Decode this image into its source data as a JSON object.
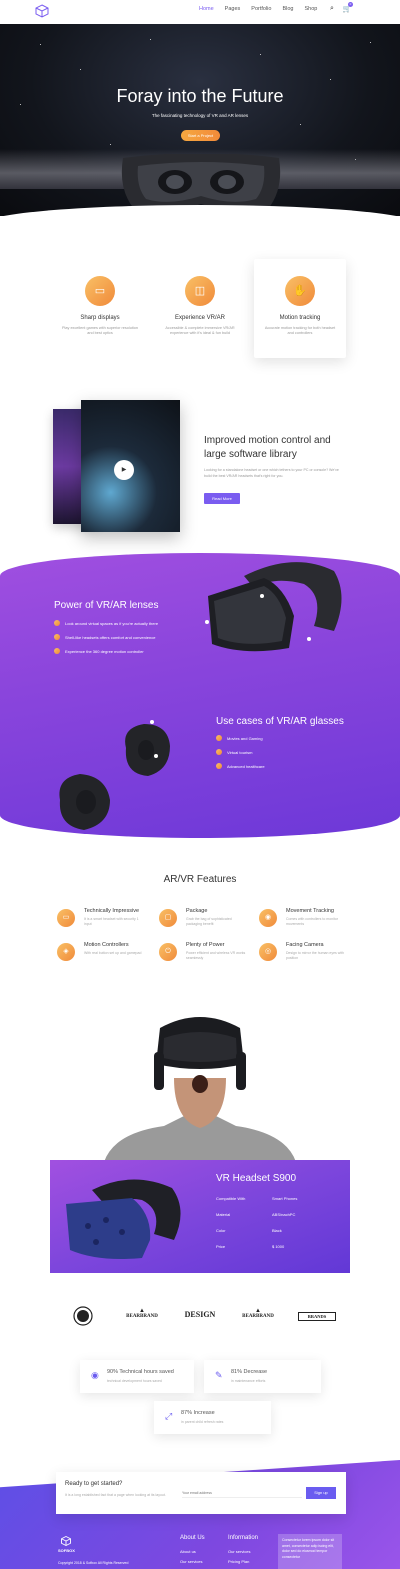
{
  "nav": {
    "items": [
      "Home",
      "Pages",
      "Portfolio",
      "Blog",
      "Shop"
    ],
    "cart_count": "0"
  },
  "hero": {
    "title": "Foray into the Future",
    "subtitle": "The fascinating technology of VR and AR lenses",
    "cta": "Start a Project"
  },
  "features": [
    {
      "icon": "vr-goggles-icon",
      "title": "Sharp displays",
      "text": "Play excellent games with superior resolution and best optics"
    },
    {
      "icon": "vr-headset-icon",
      "title": "Experience VR/AR",
      "text": "Accessible & complete immersive VR/AR experience with it's ideal & fun build"
    },
    {
      "icon": "hand-tracking-icon",
      "title": "Motion tracking",
      "text": "Accurate motion tracking for both headset and controllers"
    }
  ],
  "motion": {
    "title": "Improved motion control and large software library",
    "text": "Looking for a standalone headset or one which tethers to your PC or console? We've build the best VR/AR headsets that's right for you.",
    "button": "Read More"
  },
  "lenses": {
    "title": "Power of VR/AR lenses",
    "items": [
      "Look around virtual spaces as if you're actually there",
      "Shell-like headsets offers comfort and convenience",
      "Experience the 360 degree motion controller"
    ]
  },
  "usecases": {
    "title": "Use cases of VR/AR glasses",
    "items": [
      "Movies and Gaming",
      "Virtual tourism",
      "Advanced healthcare"
    ]
  },
  "arvr": {
    "title": "AR/VR Features",
    "items": [
      {
        "title": "Technically Impressive",
        "text": "It is a smart headset with security 1 input"
      },
      {
        "title": "Package",
        "text": "Grab the bag of sophisticated packaging benefit"
      },
      {
        "title": "Movement Tracking",
        "text": "Comes with controllers to monitor movements"
      },
      {
        "title": "Motion Controllers",
        "text": "With real button set up and gamepad"
      },
      {
        "title": "Plenty of Power",
        "text": "Power efficient and wireless VR works seamlessly"
      },
      {
        "title": "Facing Camera",
        "text": "Design to mirror the human eyes with position"
      }
    ]
  },
  "product": {
    "title": "VR Headset S900",
    "specs": [
      {
        "label": "Compatible With",
        "value": "Smart Phones"
      },
      {
        "label": "Material",
        "value": "ABS/nachPC"
      },
      {
        "label": "Color",
        "value": "Black"
      },
      {
        "label": "Price",
        "value": "$ 1000"
      }
    ]
  },
  "brands": [
    "BEARBRAND",
    "DESIGN",
    "BEARBRAND",
    "BRANDS"
  ],
  "stats": [
    {
      "title": "90% Technical hours saved",
      "text": "technical development hours saved"
    },
    {
      "title": "81% Decrease",
      "text": "in maintenance efforts"
    },
    {
      "title": "87% Increase",
      "text": "in parent child refresh rates"
    }
  ],
  "signup": {
    "title": "Ready to get started?",
    "text": "It is a long established fact that a page when looking at its layout.",
    "placeholder": "Your email address",
    "button": "Sign up"
  },
  "footer": {
    "brand": "SOFBOX",
    "copyright": "Copyright 2018 & Sofbox All Rights Reserved",
    "col1_title": "About Us",
    "col1_links": [
      "About us",
      "Our services"
    ],
    "col2_title": "Information",
    "col2_links": [
      "Our services",
      "Pricing Plan"
    ],
    "note": "Consectetur lorem ipsum dolor sit amet, consectetur adip iscing elit, dolor sed do eiusmod tempor consectetur"
  }
}
